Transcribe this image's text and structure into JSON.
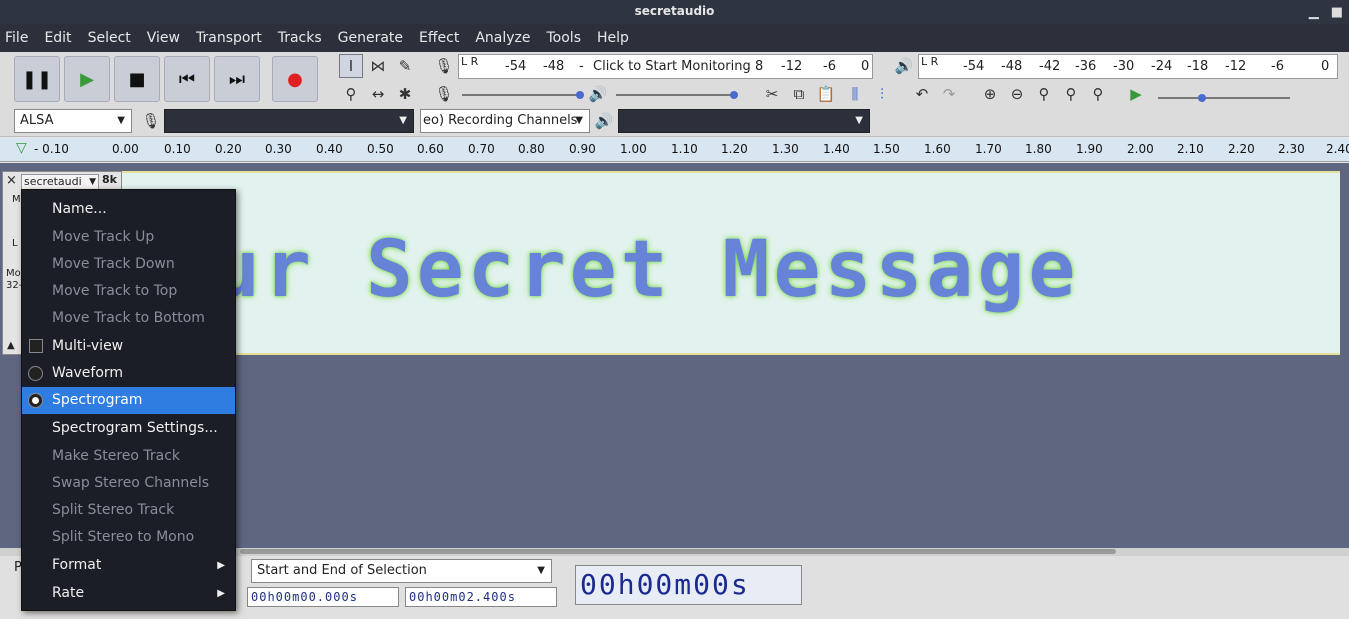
{
  "window": {
    "title": "secretaudio",
    "minimize": "▁",
    "close": "■"
  },
  "menubar": [
    "File",
    "Edit",
    "Select",
    "View",
    "Transport",
    "Tracks",
    "Generate",
    "Effect",
    "Analyze",
    "Tools",
    "Help"
  ],
  "transport": {
    "pause": "pause-icon",
    "play": "play-icon",
    "stop": "stop-icon",
    "skip_start": "skip-start-icon",
    "skip_end": "skip-end-icon",
    "record": "record-icon"
  },
  "meters": {
    "record_lr": "L R",
    "record_ticks": [
      "-54",
      "-48",
      "-",
      "Click to Start Monitoring",
      "8",
      "-12",
      "-6",
      "0"
    ],
    "play_ticks": [
      "-54",
      "-48",
      "-42",
      "-36",
      "-30",
      "-24",
      "-18",
      "-12",
      "-6",
      "0"
    ]
  },
  "devices": {
    "host": "ALSA",
    "recording_device": "",
    "channels": "eo) Recording Channels",
    "playback_device": ""
  },
  "ruler": {
    "ticks": [
      "- 0.10",
      "0.00",
      "0.10",
      "0.20",
      "0.30",
      "0.40",
      "0.50",
      "0.60",
      "0.70",
      "0.80",
      "0.90",
      "1.00",
      "1.10",
      "1.20",
      "1.30",
      "1.40",
      "1.50",
      "1.60",
      "1.70",
      "1.80",
      "1.90",
      "2.00",
      "2.10",
      "2.20",
      "2.30",
      "2.40"
    ]
  },
  "track": {
    "name": "secretaudi",
    "rate_label": "8k",
    "close": "×",
    "collapse": "▲",
    "info1": "Mo",
    "info2": "32-",
    "m": "M",
    "l": "L",
    "spectrogram_text": "our Secret Message"
  },
  "context_menu": {
    "items": [
      {
        "label": "Name...",
        "state": "enabled"
      },
      {
        "label": "Move Track Up",
        "state": "disabled"
      },
      {
        "label": "Move Track Down",
        "state": "disabled"
      },
      {
        "label": "Move Track to Top",
        "state": "disabled"
      },
      {
        "label": "Move Track to Bottom",
        "state": "disabled"
      },
      {
        "label": "Multi-view",
        "state": "enabled"
      },
      {
        "label": "Waveform",
        "state": "enabled"
      },
      {
        "label": "Spectrogram",
        "state": "selected"
      },
      {
        "label": "Spectrogram Settings...",
        "state": "enabled"
      },
      {
        "label": "Make Stereo Track",
        "state": "disabled"
      },
      {
        "label": "Swap Stereo Channels",
        "state": "disabled"
      },
      {
        "label": "Split Stereo Track",
        "state": "disabled"
      },
      {
        "label": "Split Stereo to Mono",
        "state": "disabled"
      },
      {
        "label": "Format",
        "state": "enabled"
      },
      {
        "label": "Rate",
        "state": "enabled"
      }
    ]
  },
  "selection_toolbar": {
    "project_rate_label": "P",
    "mode": "Start and End of Selection",
    "start": "00h00m00.000s",
    "end": "00h00m02.400s",
    "audio_position": "00h00m00s"
  },
  "colors": {
    "accent": "#2f7de1",
    "menu_bg": "#1b1e26",
    "track_bg": "#5f6680"
  }
}
